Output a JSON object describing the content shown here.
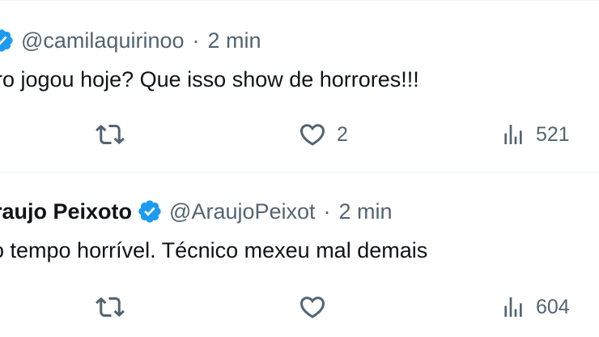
{
  "tweets": [
    {
      "display_name": "",
      "handle": "@camilaquirinoo",
      "separator": "·",
      "time": "2 min",
      "text": "ro jogou hoje? Que isso show de horrores!!!",
      "replies": "",
      "likes": "2",
      "views": "521",
      "icons": [
        "verified-badge-icon",
        "retweet-icon",
        "heart-icon",
        "views-chart-icon"
      ]
    },
    {
      "display_name": "raujo Peixoto",
      "handle": "@AraujoPeixot",
      "separator": "·",
      "time": "2 min",
      "text": "o tempo  horrível.  Técnico mexeu mal demais",
      "replies": "",
      "likes": "",
      "views": "604",
      "icons": [
        "verified-badge-icon",
        "retweet-icon",
        "heart-icon",
        "views-chart-icon"
      ]
    }
  ],
  "colors": {
    "text_primary": "#0f1419",
    "text_secondary": "#536471",
    "verified_blue": "#1d9bf0",
    "divider": "#eff3f4"
  }
}
